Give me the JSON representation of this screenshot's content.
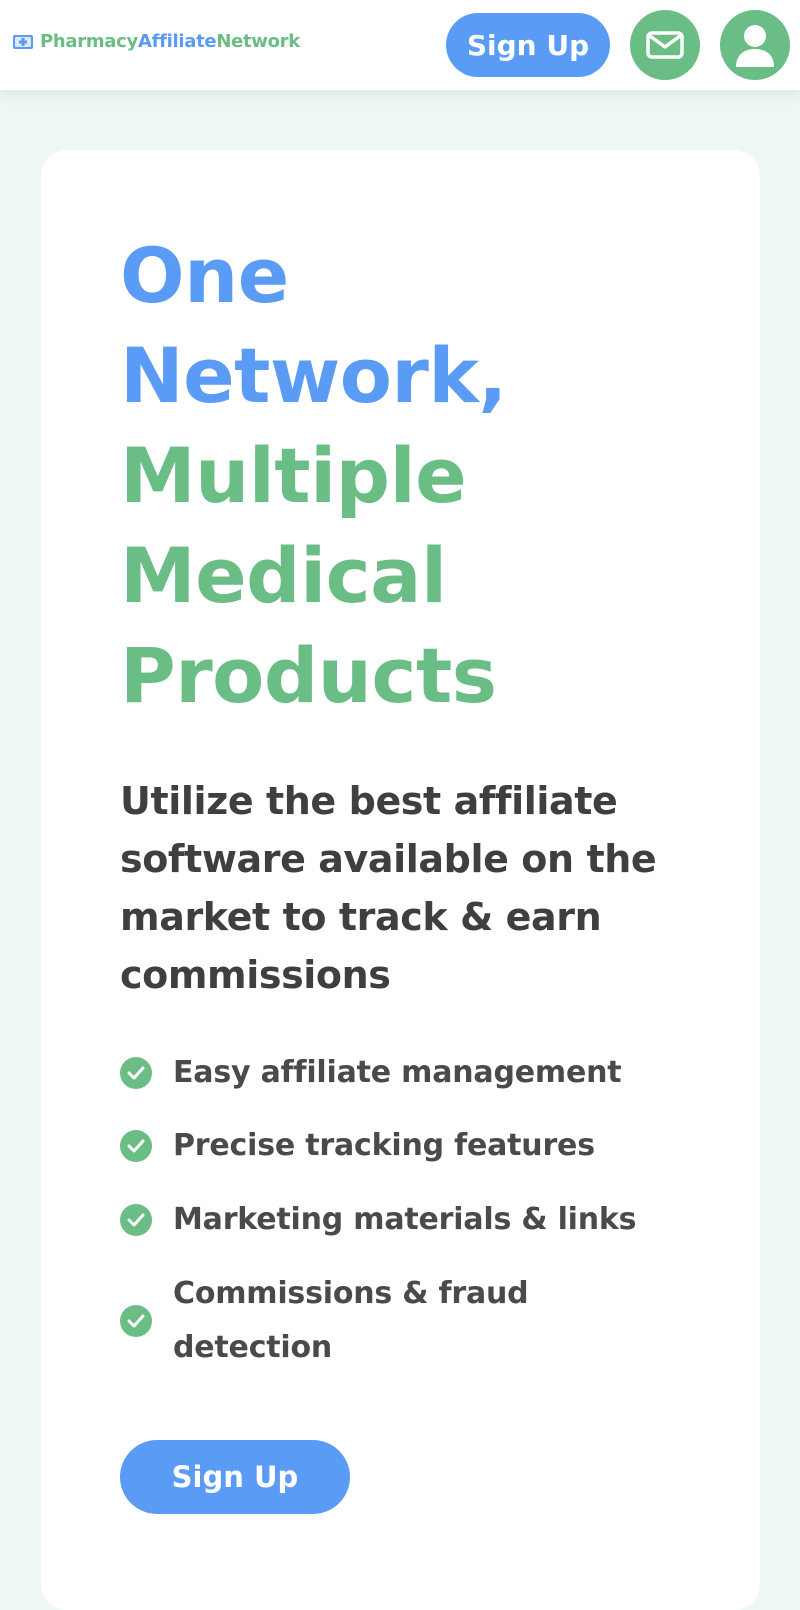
{
  "header": {
    "logo": {
      "part1": "Pharmacy",
      "part2": "Affiliate",
      "part3": "Network",
      "icon": "medical-plus-icon"
    },
    "signup_label": "Sign Up",
    "mail_icon": "mail-icon",
    "user_icon": "user-icon"
  },
  "hero": {
    "headline_line1": "One",
    "headline_line2": "Network,",
    "headline_line3": "Multiple",
    "headline_line4": "Medical",
    "headline_line5": "Products",
    "subheadline": "Utilize the best affiliate software available on the market to track & earn commissions",
    "features": [
      "Easy affiliate management",
      "Precise tracking features",
      "Marketing materials & links",
      "Commissions & fraud detection"
    ],
    "feature_icon": "check-circle-icon",
    "cta_label": "Sign Up"
  },
  "colors": {
    "primary_blue": "#5a9bf6",
    "primary_green": "#6bbd86",
    "background": "#eef7f2",
    "text_dark": "#3f3f3f"
  }
}
